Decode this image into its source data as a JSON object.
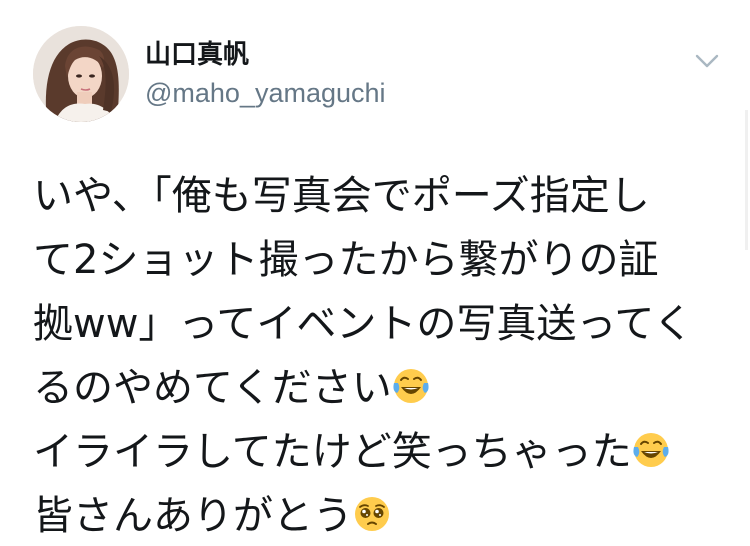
{
  "tweet": {
    "display_name": "山口真帆",
    "handle": "@maho_yamaguchi",
    "lines": [
      {
        "text": "いや、「俺も写真会でポーズ指定し",
        "emoji": ""
      },
      {
        "text": "て2ショット撮ったから繋がりの証",
        "emoji": ""
      },
      {
        "text": "拠ww」ってイベントの写真送ってく",
        "emoji": ""
      },
      {
        "text": "るのやめてください",
        "emoji": "face-with-tears-of-joy"
      },
      {
        "text": "イライラしてたけど笑っちゃった",
        "emoji": "face-with-tears-of-joy"
      },
      {
        "text": "皆さんありがとう",
        "emoji": "pleading-face"
      }
    ],
    "icons": {
      "caret": "chevron-down-icon",
      "avatar": "profile-photo"
    },
    "colors": {
      "text": "#14171a",
      "secondary": "#657786",
      "caret": "#aab8c2",
      "emoji_face": "#ffcc4d",
      "emoji_tear": "#5dadec"
    }
  }
}
